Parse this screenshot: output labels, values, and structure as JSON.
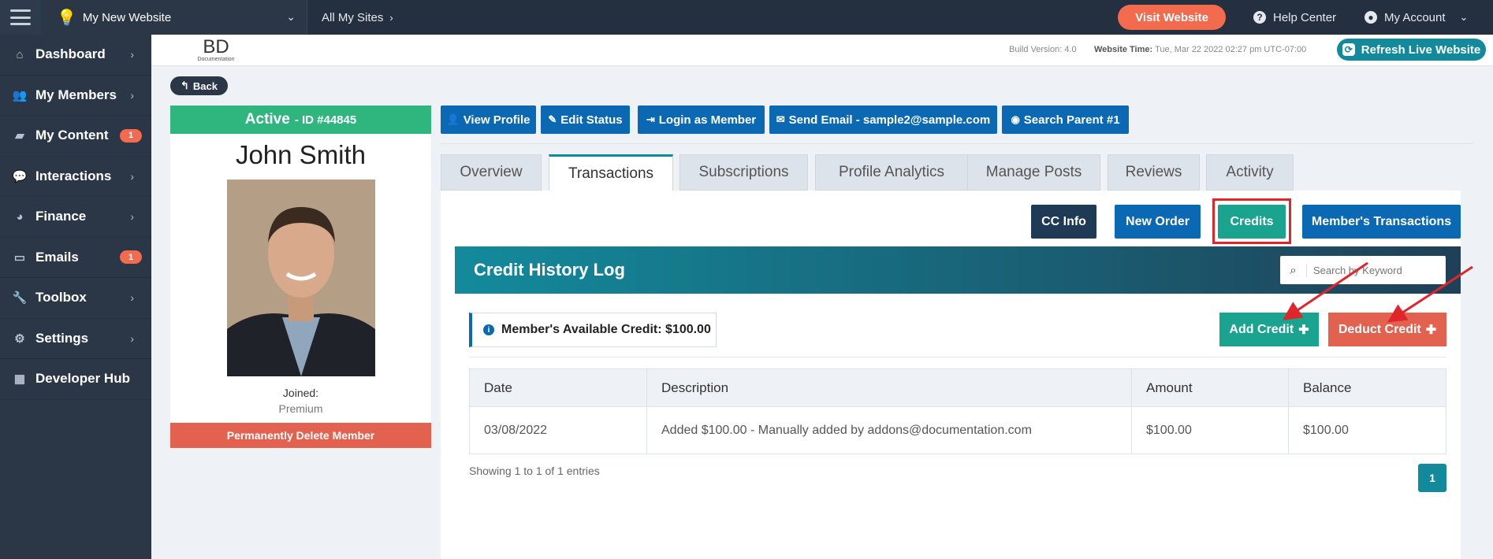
{
  "topbar": {
    "site_name": "My New Website",
    "all_sites": "All My Sites",
    "visit_website": "Visit Website",
    "help_center": "Help Center",
    "my_account": "My Account"
  },
  "sidebar": {
    "items": [
      {
        "label": "Dashboard",
        "icon": "home-icon"
      },
      {
        "label": "My Members",
        "icon": "users-icon"
      },
      {
        "label": "My Content",
        "icon": "folder-icon",
        "badge": "1"
      },
      {
        "label": "Interactions",
        "icon": "chat-icon"
      },
      {
        "label": "Finance",
        "icon": "pie-chart-icon"
      },
      {
        "label": "Emails",
        "icon": "inbox-icon",
        "badge": "1"
      },
      {
        "label": "Toolbox",
        "icon": "wrench-icon"
      },
      {
        "label": "Settings",
        "icon": "gear-icon"
      },
      {
        "label": "Developer Hub",
        "icon": "grid-icon"
      }
    ]
  },
  "subheader": {
    "logo_text": "BD",
    "logo_sub": "Documentation",
    "build_version": "Build Version: 4.0",
    "website_time_label": "Website Time:",
    "website_time": "Tue, Mar 22 2022 02:27 pm UTC-07:00",
    "refresh_live": "Refresh Live Website"
  },
  "back_label": "Back",
  "profile": {
    "status": "Active",
    "id": "- ID #44845",
    "name": "John Smith",
    "joined": "Joined:",
    "plan": "Premium",
    "delete_label": "Permanently Delete Member"
  },
  "actions": {
    "view_profile": "View Profile",
    "edit_status": "Edit Status",
    "login_as_member": "Login as Member",
    "send_email": "Send Email - sample2@sample.com",
    "search_parent": "Search Parent #1"
  },
  "tabs": [
    "Overview",
    "Transactions",
    "Subscriptions",
    "Profile Analytics",
    "Manage Posts",
    "Reviews",
    "Activity"
  ],
  "panel": {
    "cc_info": "CC Info",
    "new_order": "New Order",
    "credits": "Credits",
    "members_transactions": "Member's Transactions",
    "log_title": "Credit History Log",
    "search_placeholder": "Search by Keyword",
    "available_credit": "Member's Available Credit: $100.00",
    "add_credit": "Add Credit",
    "deduct_credit": "Deduct Credit",
    "columns": [
      "Date",
      "Description",
      "Amount",
      "Balance"
    ],
    "rows": [
      [
        "03/08/2022",
        "Added $100.00 - Manually added by addons@documentation.com",
        "$100.00",
        "$100.00"
      ]
    ],
    "showing": "Showing 1 to 1 of 1 entries",
    "page": "1"
  },
  "colors": {
    "topbar": "#24303f",
    "sidebar": "#2b3747",
    "primary_blue": "#0b69b4",
    "teal": "#138a9c",
    "green": "#2fb67e",
    "orange": "#f26b4f",
    "highlight_red": "#e0262b"
  }
}
